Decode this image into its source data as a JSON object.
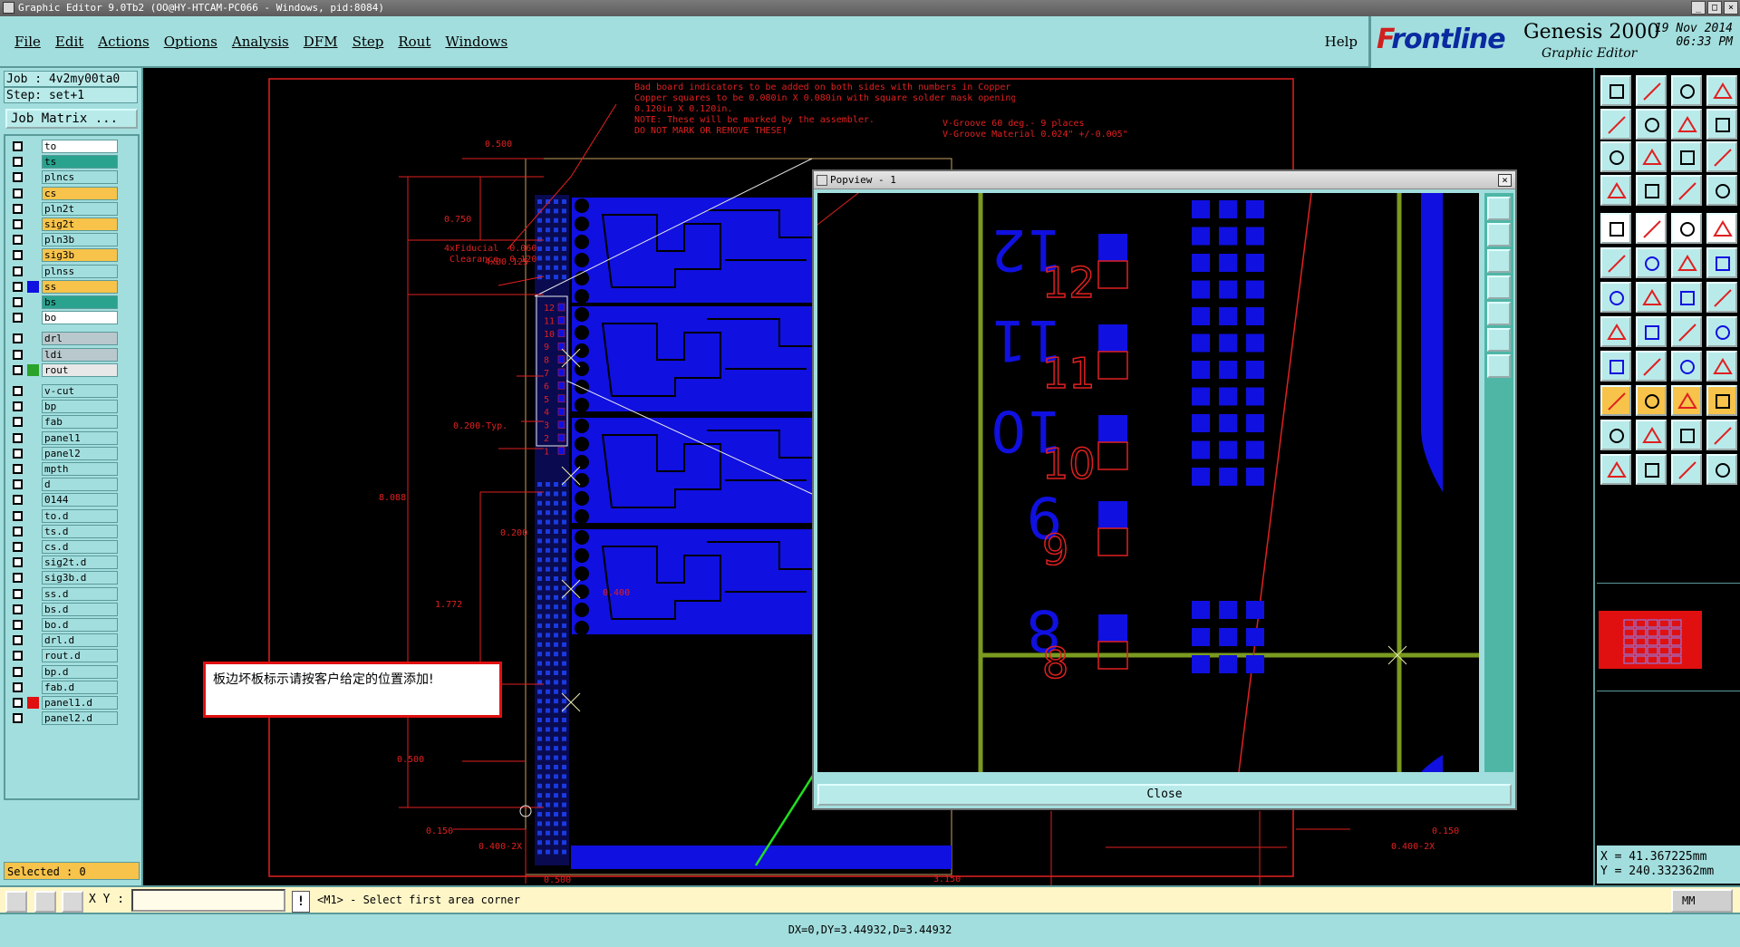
{
  "window": {
    "title": "Graphic Editor 9.0Tb2 (OO@HY-HTCAM-PC066 - Windows, pid:8084)",
    "buttons": [
      "_",
      "□",
      "×"
    ]
  },
  "menu": {
    "items": [
      "File",
      "Edit",
      "Actions",
      "Options",
      "Analysis",
      "DFM",
      "Step",
      "Rout",
      "Windows"
    ],
    "help": "Help"
  },
  "brand": {
    "logo": "Frontline",
    "product": "Genesis 2000",
    "subtitle": "Graphic Editor",
    "date": "19 Nov 2014",
    "time": "06:33 PM"
  },
  "job": {
    "job_line": "Job : 4v2my00ta0",
    "step_line": "Step: set+1",
    "matrix_button": "Job Matrix ..."
  },
  "layers": [
    {
      "name": "to",
      "color": "#ffffff",
      "swatch": ""
    },
    {
      "name": "ts",
      "color": "#2aa38e",
      "swatch": ""
    },
    {
      "name": "plncs",
      "color": "#a3dede",
      "swatch": ""
    },
    {
      "name": "cs",
      "color": "#f7c34a",
      "swatch": ""
    },
    {
      "name": "pln2t",
      "color": "#a3dede",
      "swatch": ""
    },
    {
      "name": "sig2t",
      "color": "#f7c34a",
      "swatch": ""
    },
    {
      "name": "pln3b",
      "color": "#a3dede",
      "swatch": ""
    },
    {
      "name": "sig3b",
      "color": "#f7c34a",
      "swatch": ""
    },
    {
      "name": "plnss",
      "color": "#a3dede",
      "swatch": ""
    },
    {
      "name": "ss",
      "color": "#f7c34a",
      "swatch": "#1010e0"
    },
    {
      "name": "bs",
      "color": "#2aa38e",
      "swatch": ""
    },
    {
      "name": "bo",
      "color": "#ffffff",
      "swatch": ""
    },
    {
      "name": "drl",
      "color": "#b9c8cc",
      "swatch": ""
    },
    {
      "name": "ldi",
      "color": "#b9c8cc",
      "swatch": ""
    },
    {
      "name": "rout",
      "color": "#e8e8e8",
      "swatch": "#2aa32a"
    },
    {
      "name": "v-cut",
      "color": "#a3dede",
      "swatch": ""
    },
    {
      "name": "bp",
      "color": "#a3dede",
      "swatch": ""
    },
    {
      "name": "fab",
      "color": "#a3dede",
      "swatch": ""
    },
    {
      "name": "panel1",
      "color": "#a3dede",
      "swatch": ""
    },
    {
      "name": "panel2",
      "color": "#a3dede",
      "swatch": ""
    },
    {
      "name": "mpth",
      "color": "#a3dede",
      "swatch": ""
    },
    {
      "name": "d",
      "color": "#a3dede",
      "swatch": ""
    },
    {
      "name": "0144",
      "color": "#a3dede",
      "swatch": ""
    },
    {
      "name": "to.d",
      "color": "#a3dede",
      "swatch": ""
    },
    {
      "name": "ts.d",
      "color": "#a3dede",
      "swatch": ""
    },
    {
      "name": "cs.d",
      "color": "#a3dede",
      "swatch": "",
      "edit": "✎"
    },
    {
      "name": "sig2t.d",
      "color": "#a3dede",
      "swatch": "",
      "edit": "✎"
    },
    {
      "name": "sig3b.d",
      "color": "#a3dede",
      "swatch": "",
      "edit": "✎"
    },
    {
      "name": "ss.d",
      "color": "#a3dede",
      "swatch": "",
      "edit": "✎"
    },
    {
      "name": "bs.d",
      "color": "#a3dede",
      "swatch": ""
    },
    {
      "name": "bo.d",
      "color": "#a3dede",
      "swatch": ""
    },
    {
      "name": "drl.d",
      "color": "#a3dede",
      "swatch": ""
    },
    {
      "name": "rout.d",
      "color": "#a3dede",
      "swatch": ""
    },
    {
      "name": "bp.d",
      "color": "#a3dede",
      "swatch": ""
    },
    {
      "name": "fab.d",
      "color": "#a3dede",
      "swatch": ""
    },
    {
      "name": "panel1.d",
      "color": "#a3dede",
      "swatch": "#e01010",
      "edit": "✎✎"
    },
    {
      "name": "panel2.d",
      "color": "#a3dede",
      "swatch": "",
      "edit": "✎✎"
    }
  ],
  "selected_label": "Selected : 0",
  "canvas": {
    "note_lines": "Bad board indicators to be added on both sides with numbers in Copper\nCopper squares to be 0.080in X 0.080in with square solder mask openings to be\n0.120in X 0.120in.\nNOTE: These will be marked by the assembler.\nDO NOT MARK OR REMOVE THESE!",
    "vgroove": "V-Groove 60 deg.- 9 places\nV-Groove Material 0.024\" +/-0.005\"",
    "fiducial": "4xFiducial  0.060\n Clearance  0.120",
    "dims": {
      "d1": "0.500",
      "d2": "0.750",
      "d3": "4xØ0.125",
      "d4": "0.200-Typ.",
      "d5": "0.200",
      "d6": "8.088",
      "d7": "1.772",
      "d8": "0.500",
      "d9": "0.150",
      "d10": "0.400-2X",
      "d11": "0.400",
      "d12": "3.150",
      "d13": "0.150",
      "d14": "0.400-2X",
      "d15": "0.500"
    },
    "board_numbers": [
      "12",
      "11",
      "10",
      "9",
      "8",
      "7",
      "6",
      "5",
      "4",
      "3",
      "2",
      "1"
    ],
    "annotation": "板边坏板标示请按客户给定的位置添加!"
  },
  "popview": {
    "title": "Popview - 1",
    "close_x": "×",
    "close_button": "Close",
    "digits": [
      "12",
      "11",
      "10",
      "9",
      "8"
    ]
  },
  "coords": {
    "x": "X  =  41.367225mm",
    "y": "Y  =  240.332362mm"
  },
  "status": {
    "xy_label": "X Y :",
    "xy_value": "",
    "exclam": "!",
    "prompt": "<M1> - Select first area corner",
    "units": "MM",
    "delta": "DX=0,DY=3.44932,D=3.44932"
  },
  "colors": {
    "teal": "#a3dede",
    "copper_blue": "#1010e0",
    "drawing_red": "#e02020",
    "vcut_green": "#7a9a20",
    "pointer_green": "#20e020"
  }
}
